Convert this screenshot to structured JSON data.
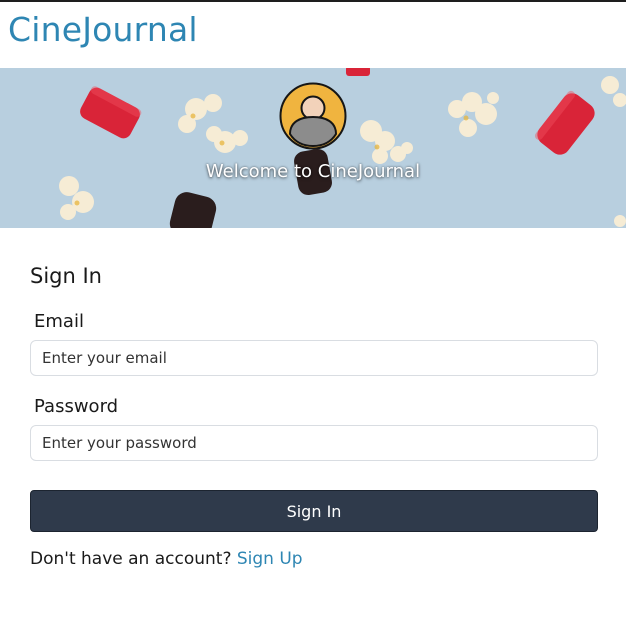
{
  "header": {
    "brand": "CineJournal"
  },
  "hero": {
    "title": "Welcome to CineJournal",
    "avatar_icon": "user-avatar-icon",
    "colors": {
      "background": "#b8cfdf",
      "avatar_ring": "#f0b43f",
      "licorice_red": "#d92438",
      "licorice_black": "#2a1d1d",
      "popcorn": "#f6ecd5"
    }
  },
  "signin": {
    "title": "Sign In",
    "email_label": "Email",
    "email_placeholder": "Enter your email",
    "password_label": "Password",
    "password_placeholder": "Enter your password",
    "submit_label": "Sign In",
    "signup_prompt": "Don't have an account?",
    "signup_link": "Sign Up"
  },
  "colors": {
    "brand": "#2e86b3",
    "button_background": "#2f3a4b",
    "link": "#2e86b3"
  }
}
